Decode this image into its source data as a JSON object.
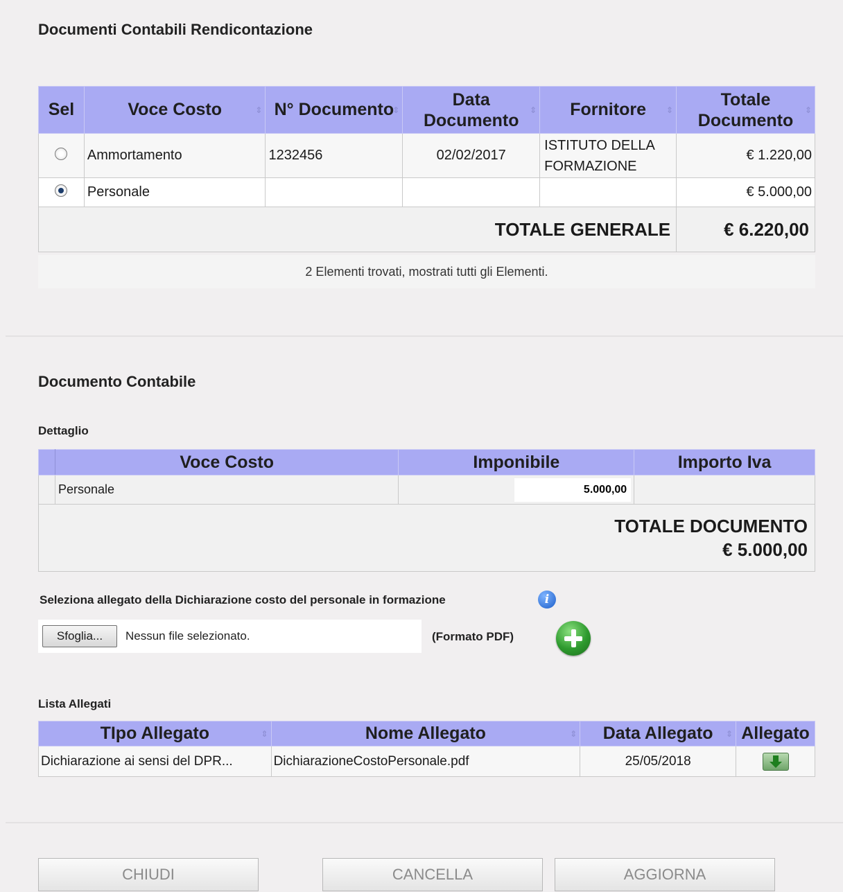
{
  "section1": {
    "title": "Documenti Contabili Rendicontazione",
    "table": {
      "headers": [
        "Sel",
        "Voce Costo",
        "N° Documento",
        "Data Documento",
        "Fornitore",
        "Totale Documento"
      ],
      "rows": [
        {
          "selected": false,
          "voce": "Ammortamento",
          "numero": "1232456",
          "data": "02/02/2017",
          "fornitore": "ISTITUTO DELLA FORMAZIONE",
          "totale": "€ 1.220,00"
        },
        {
          "selected": true,
          "voce": "Personale",
          "numero": "",
          "data": "",
          "fornitore": "",
          "totale": "€ 5.000,00"
        }
      ],
      "totale_label": "TOTALE GENERALE",
      "totale_value": "€ 6.220,00",
      "footer": "2 Elementi trovati, mostrati tutti gli Elementi."
    }
  },
  "section2": {
    "title": "Documento Contabile",
    "dettaglio_title": "Dettaglio",
    "dettaglio": {
      "headers": [
        "Voce Costo",
        "Imponibile",
        "Importo Iva"
      ],
      "row": {
        "voce": "Personale",
        "imponibile": "5.000,00",
        "iva": ""
      },
      "totale_label": "TOTALE DOCUMENTO",
      "totale_value": "€ 5.000,00"
    },
    "upload": {
      "label": "Seleziona allegato della Dichiarazione costo del personale in formazione",
      "browse_button": "Sfoglia...",
      "file_status": "Nessun file selezionato.",
      "format_hint": "(Formato PDF)"
    },
    "allegati_title": "Lista Allegati",
    "allegati": {
      "headers": [
        "TIpo Allegato",
        "Nome Allegato",
        "Data Allegato",
        "Allegato"
      ],
      "rows": [
        {
          "tipo": "Dichiarazione ai sensi del DPR...",
          "nome": "DichiarazioneCostoPersonale.pdf",
          "data": "25/05/2018"
        }
      ]
    }
  },
  "buttons": {
    "chiudi": "CHIUDI",
    "cancella": "CANCELLA",
    "aggiorna": "AGGIORNA"
  },
  "colors": {
    "header_bg": "#a9aaf3",
    "page_bg": "#f1eff0",
    "add_icon": "#2e9a2e",
    "info_icon": "#2a6fd6"
  },
  "icons": [
    "info-icon",
    "add-icon",
    "download-icon",
    "sort-icon"
  ]
}
